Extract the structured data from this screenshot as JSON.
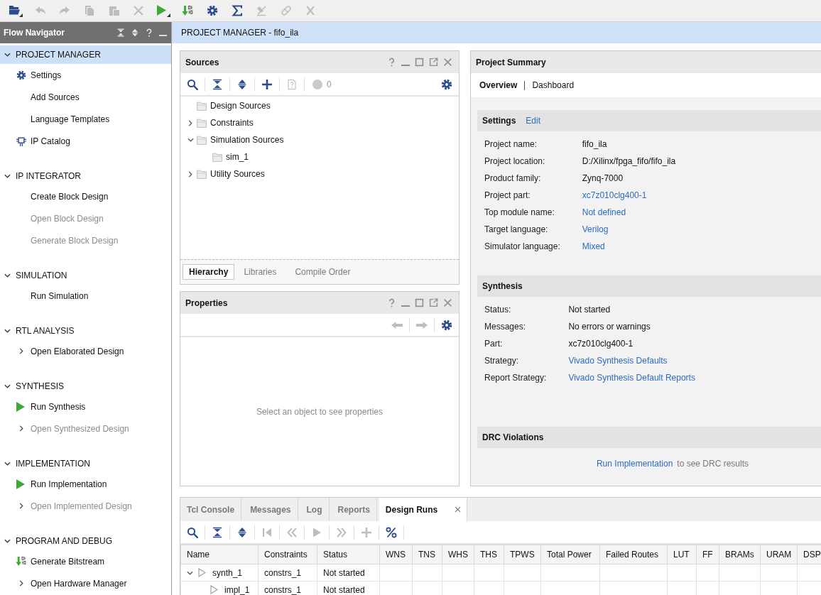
{
  "toolbar": [
    {
      "disabled": false
    },
    {
      "disabled": true
    },
    {
      "disabled": true
    },
    {
      "disabled": true
    },
    {
      "disabled": true
    },
    {
      "disabled": true
    },
    {
      "disabled": false
    },
    {
      "disabled": false
    },
    {
      "disabled": false
    },
    {
      "disabled": false
    },
    {
      "disabled": true
    },
    {
      "disabled": true
    },
    {
      "disabled": true
    }
  ],
  "flow_navigator": {
    "title": "Flow Navigator",
    "sections": [
      {
        "title": "PROJECT MANAGER",
        "expanded": true,
        "selected": true,
        "items": [
          {
            "label": "Settings",
            "kind": "settings",
            "disabled": false
          },
          {
            "label": "Add Sources",
            "kind": "plain",
            "disabled": false
          },
          {
            "label": "Language Templates",
            "kind": "plain",
            "disabled": false
          },
          {
            "label": "IP Catalog",
            "kind": "ip",
            "disabled": false
          }
        ]
      },
      {
        "title": "IP INTEGRATOR",
        "expanded": true,
        "selected": false,
        "items": [
          {
            "label": "Create Block Design",
            "kind": "plain",
            "disabled": false
          },
          {
            "label": "Open Block Design",
            "kind": "plain",
            "disabled": true
          },
          {
            "label": "Generate Block Design",
            "kind": "plain",
            "disabled": true
          }
        ]
      },
      {
        "title": "SIMULATION",
        "expanded": true,
        "selected": false,
        "items": [
          {
            "label": "Run Simulation",
            "kind": "plain",
            "disabled": false
          }
        ]
      },
      {
        "title": "RTL ANALYSIS",
        "expanded": true,
        "selected": false,
        "items": [
          {
            "label": "Open Elaborated Design",
            "kind": "submenu",
            "expanded": false,
            "disabled": false
          }
        ]
      },
      {
        "title": "SYNTHESIS",
        "expanded": true,
        "selected": false,
        "items": [
          {
            "label": "Run Synthesis",
            "kind": "run",
            "disabled": false
          },
          {
            "label": "Open Synthesized Design",
            "kind": "submenu",
            "expanded": false,
            "disabled": true
          }
        ]
      },
      {
        "title": "IMPLEMENTATION",
        "expanded": true,
        "selected": false,
        "items": [
          {
            "label": "Run Implementation",
            "kind": "run",
            "disabled": false
          },
          {
            "label": "Open Implemented Design",
            "kind": "submenu",
            "expanded": false,
            "disabled": true
          }
        ]
      },
      {
        "title": "PROGRAM AND DEBUG",
        "expanded": true,
        "selected": false,
        "items": [
          {
            "label": "Generate Bitstream",
            "kind": "bitstream",
            "disabled": false
          },
          {
            "label": "Open Hardware Manager",
            "kind": "submenu",
            "expanded": false,
            "disabled": false
          }
        ]
      }
    ]
  },
  "header": {
    "title": "PROJECT MANAGER - fifo_ila"
  },
  "sources": {
    "title": "Sources",
    "toolbar": [
      {
        "disabled": false
      },
      {
        "disabled": false
      },
      {
        "disabled": false
      },
      {
        "disabled": false
      },
      {
        "disabled": true
      }
    ],
    "message_count": "0",
    "tree": [
      {
        "label": "Design Sources"
      },
      {
        "label": "Constraints",
        "expanded": false
      },
      {
        "label": "Simulation Sources",
        "expanded": true,
        "children": [
          {
            "label": "sim_1"
          }
        ]
      },
      {
        "label": "Utility Sources",
        "expanded": false
      }
    ],
    "tabs": [
      {
        "label": "Hierarchy",
        "selected": true
      },
      {
        "label": "Libraries",
        "selected": false
      },
      {
        "label": "Compile Order",
        "selected": false
      }
    ]
  },
  "properties": {
    "title": "Properties",
    "back": {
      "disabled": true
    },
    "forward": {
      "disabled": true
    },
    "message": "Select an object to see properties"
  },
  "project_summary": {
    "title": "Project Summary",
    "tabs": [
      {
        "label": "Overview",
        "selected": true
      },
      {
        "label": "Dashboard",
        "selected": false
      }
    ],
    "sections": [
      {
        "title": "Settings",
        "action": "Edit",
        "rows": [
          {
            "label": "Project name:",
            "value": "fifo_ila",
            "link": false
          },
          {
            "label": "Project location:",
            "value": "D:/Xilinx/fpga_fifo/fifo_ila",
            "link": false
          },
          {
            "label": "Product family:",
            "value": "Zynq-7000",
            "link": false
          },
          {
            "label": "Project part:",
            "value": "xc7z010clg400-1",
            "link": true
          },
          {
            "label": "Top module name:",
            "value": "Not defined",
            "link": true
          },
          {
            "label": "Target language:",
            "value": "Verilog",
            "link": true
          },
          {
            "label": "Simulator language:",
            "value": "Mixed",
            "link": true
          }
        ]
      },
      {
        "title": "Synthesis",
        "rows": [
          {
            "label": "Status:",
            "value": "Not started",
            "link": false
          },
          {
            "label": "Messages:",
            "value": "No errors or warnings",
            "link": false
          },
          {
            "label": "Part:",
            "value": "xc7z010clg400-1",
            "link": false
          },
          {
            "label": "Strategy:",
            "value": "Vivado Synthesis Defaults",
            "link": true
          },
          {
            "label": "Report Strategy:",
            "value": "Vivado Synthesis Default Reports",
            "link": true
          }
        ]
      },
      {
        "title": "DRC Violations",
        "message": {
          "link": "Run Implementation",
          "text": "to see DRC results"
        }
      }
    ]
  },
  "bottom_panel": {
    "tabs": [
      {
        "label": "Tcl Console",
        "selected": false
      },
      {
        "label": "Messages",
        "selected": false
      },
      {
        "label": "Log",
        "selected": false
      },
      {
        "label": "Reports",
        "selected": false
      },
      {
        "label": "Design Runs",
        "selected": true
      }
    ],
    "toolbar": [
      {
        "disabled": false
      },
      {
        "disabled": false
      },
      {
        "disabled": false
      },
      {
        "disabled": true
      },
      {
        "disabled": true
      },
      {
        "disabled": true
      },
      {
        "disabled": true
      },
      {
        "disabled": true
      },
      {
        "disabled": false
      }
    ],
    "table": {
      "columns": [
        "Name",
        "Constraints",
        "Status",
        "WNS",
        "TNS",
        "WHS",
        "THS",
        "TPWS",
        "Total Power",
        "Failed Routes",
        "LUT",
        "FF",
        "BRAMs",
        "URAM",
        "DSP"
      ],
      "rows": [
        {
          "cells": [
            "synth_1",
            "constrs_1",
            "Not started"
          ],
          "expanded": true,
          "children": [
            {
              "cells": [
                "impl_1",
                "constrs_1",
                "Not started"
              ]
            }
          ]
        }
      ]
    }
  }
}
